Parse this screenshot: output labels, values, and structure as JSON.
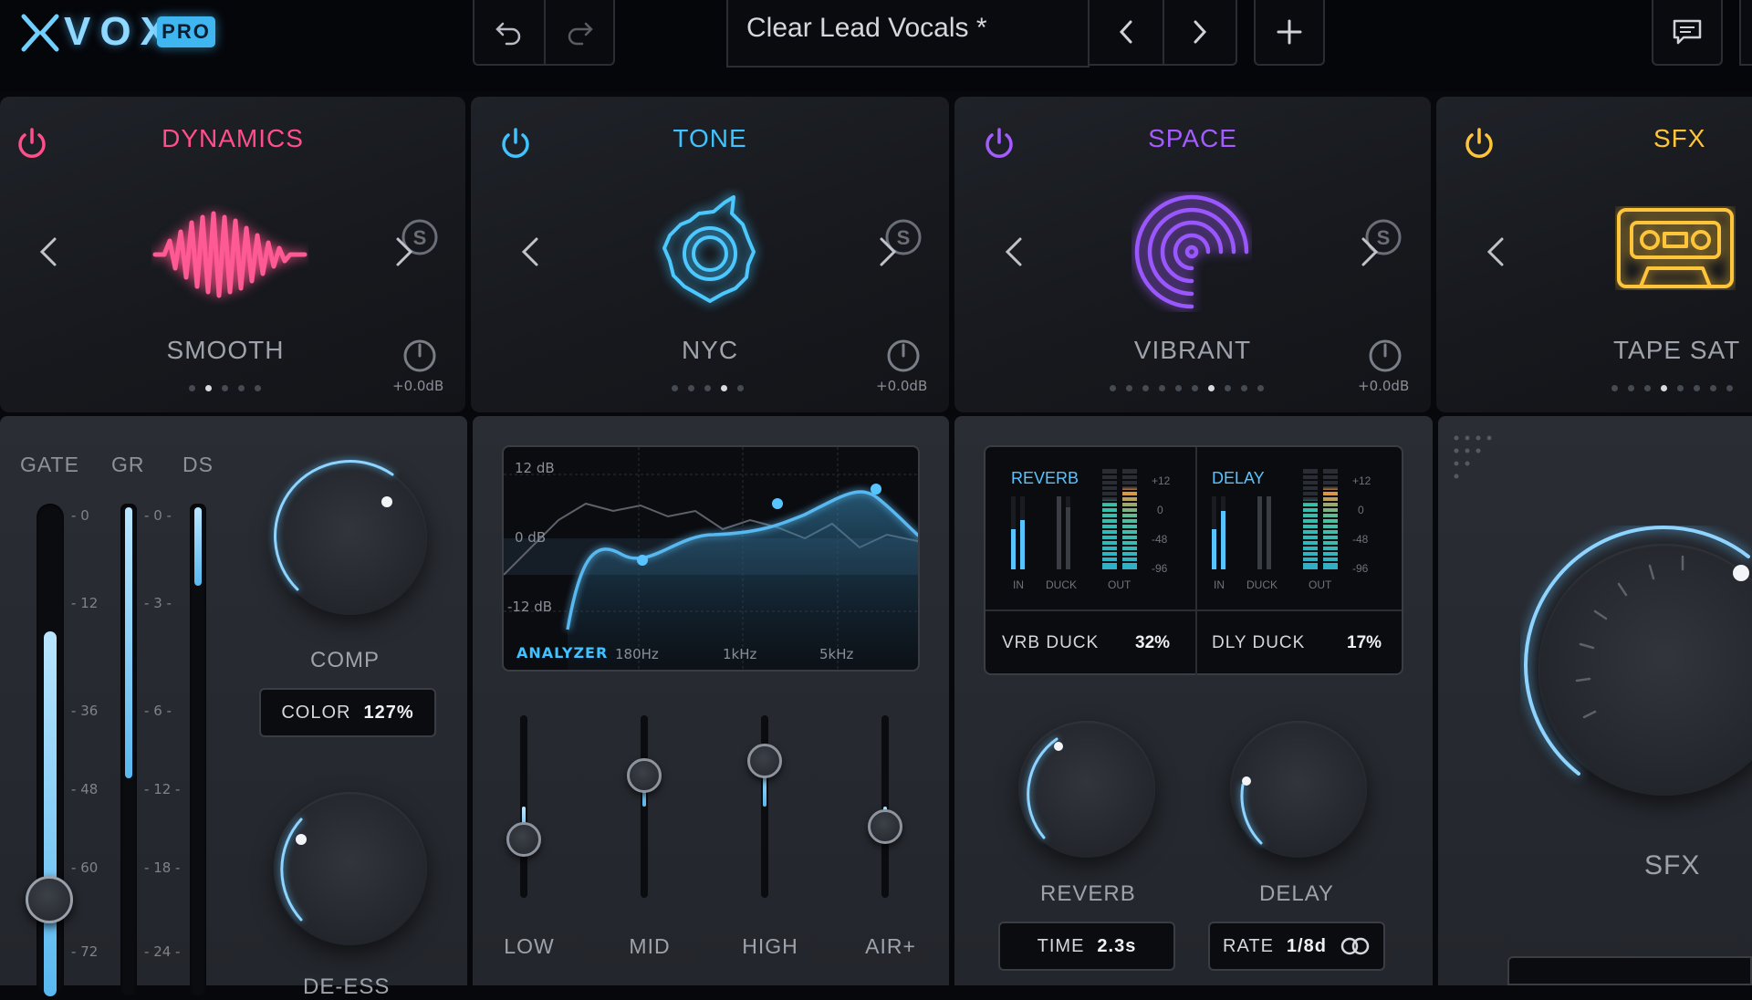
{
  "header": {
    "logo": "VOX",
    "logo_badge": "PRO",
    "preset_name": "Clear Lead Vocals *"
  },
  "modules": [
    {
      "id": "dynamics",
      "title": "DYNAMICS",
      "preset": "SMOOTH",
      "gain": "+0.0dB",
      "color": "#ff4f8b",
      "dots": 5,
      "active_dot": 2
    },
    {
      "id": "tone",
      "title": "TONE",
      "preset": "NYC",
      "gain": "+0.0dB",
      "color": "#3fc2ff",
      "dots": 5,
      "active_dot": 4
    },
    {
      "id": "space",
      "title": "SPACE",
      "preset": "VIBRANT",
      "gain": "+0.0dB",
      "color": "#a45cff",
      "dots": 10,
      "active_dot": 7
    },
    {
      "id": "sfx",
      "title": "SFX",
      "preset": "TAPE SAT",
      "gain": "",
      "color": "#ffc53a",
      "dots": 8,
      "active_dot": 4
    }
  ],
  "dynamics_panel": {
    "meter_labels": [
      "GATE",
      "GR",
      "DS"
    ],
    "gate_scale": [
      "0",
      "12",
      "36",
      "48",
      "60",
      "72"
    ],
    "gr_scale": [
      "0",
      "3",
      "6",
      "12",
      "18",
      "24"
    ],
    "gate_level": 0.74,
    "gr_level": 0.55,
    "ds_level": 0.16,
    "comp_label": "COMP",
    "color_label": "COLOR",
    "color_value": "127%",
    "deess_label": "DE-ESS"
  },
  "tone_panel": {
    "db_labels": [
      "12 dB",
      "0 dB",
      "-12 dB"
    ],
    "freq_labels": [
      "180Hz",
      "1kHz",
      "5kHz"
    ],
    "analyzer_label": "ANALYZER",
    "bands": [
      {
        "label": "LOW",
        "value": 0.32
      },
      {
        "label": "MID",
        "value": 0.67
      },
      {
        "label": "HIGH",
        "value": 0.75
      },
      {
        "label": "AIR+",
        "value": 0.39
      }
    ]
  },
  "space_panel": {
    "reverb_meter_title": "REVERB",
    "delay_meter_title": "DELAY",
    "meter_sub_labels": [
      "IN",
      "DUCK",
      "OUT"
    ],
    "meter_scale": [
      "+12",
      "0",
      "-48",
      "-96"
    ],
    "vrb_duck_label": "VRB DUCK",
    "vrb_duck_value": "32%",
    "dly_duck_label": "DLY DUCK",
    "dly_duck_value": "17%",
    "reverb_label": "REVERB",
    "delay_label": "DELAY",
    "time_label": "TIME",
    "time_value": "2.3s",
    "rate_label": "RATE",
    "rate_value": "1/8d"
  },
  "sfx_panel": {
    "knob_label": "SFX"
  },
  "colors": {
    "accent": "#58b8f0",
    "background": "#07080b",
    "panel": "#2a2d34"
  }
}
